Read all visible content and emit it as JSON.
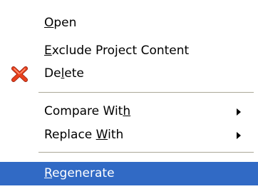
{
  "menu": {
    "items": [
      {
        "label": "Open",
        "underline": "O"
      },
      {
        "label": "Exclude Project Content",
        "underline": "E"
      },
      {
        "label": "Delete",
        "underline": "l",
        "icon": "red-x-delete-icon",
        "icon_color": "#d92d12"
      },
      {
        "label": "Compare With",
        "underline": "h",
        "submenu": true
      },
      {
        "label": "Replace With",
        "underline": "W",
        "submenu": true
      },
      {
        "label": "Regenerate",
        "underline": "R",
        "selected": true
      }
    ],
    "selection_color": "#316ac5",
    "separator_color": "#aca899"
  }
}
